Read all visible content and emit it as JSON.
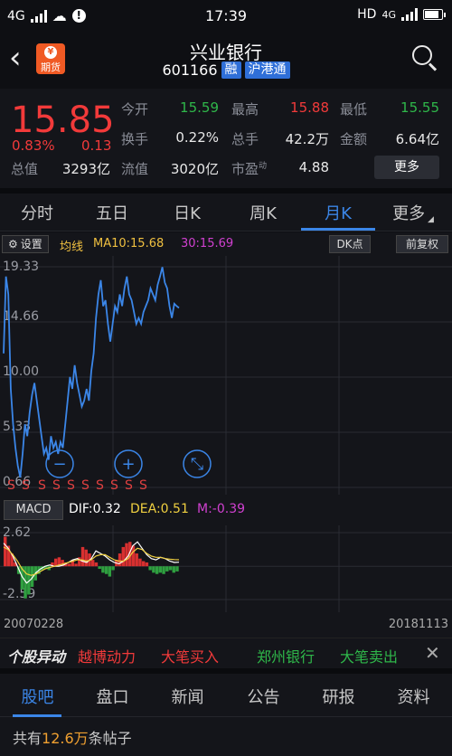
{
  "status_bar": {
    "network_left": "4G",
    "time": "17:39",
    "hd": "HD",
    "network_right": "4G"
  },
  "header": {
    "back_icon": "chevron-left-icon",
    "futures_label": "期货",
    "stock_name": "兴业银行",
    "stock_code": "601166",
    "tag_margin": "融",
    "tag_connect": "沪港通",
    "search_icon": "search-icon"
  },
  "quote": {
    "price": "15.85",
    "change_pct": "0.83%",
    "change_amt": "0.13",
    "total_value_label": "总值",
    "total_value": "3293亿",
    "rows": [
      {
        "label": "今开",
        "value": "15.59",
        "color": "green"
      },
      {
        "label": "最高",
        "value": "15.88",
        "color": "red"
      },
      {
        "label": "最低",
        "value": "15.55",
        "color": "green"
      },
      {
        "label": "换手",
        "value": "0.22%",
        "color": "white"
      },
      {
        "label": "总手",
        "value": "42.2万",
        "color": "white"
      },
      {
        "label": "金额",
        "value": "6.64亿",
        "color": "white"
      },
      {
        "label": "流值",
        "value": "3020亿",
        "color": "white"
      },
      {
        "label": "市盈",
        "superscript": "动",
        "value": "4.88",
        "color": "white"
      }
    ],
    "more_label": "更多"
  },
  "tabs": {
    "items": [
      "分时",
      "五日",
      "日K",
      "周K",
      "月K",
      "更多"
    ],
    "active_index": 4
  },
  "chart_toolbar": {
    "settings_label": "设置",
    "ma_label": "均线",
    "ma10": "MA10:15.68",
    "ma30": "30:15.69",
    "dk_label": "DK点",
    "adjust_label": "前复权",
    "colors": {
      "ma10": "#f0c040",
      "ma30": "#d040d0"
    }
  },
  "chart_data": [
    {
      "type": "line",
      "title": "",
      "y_tick_labels": [
        "19.33",
        "14.66",
        "10.00",
        "5.33",
        "0.66"
      ],
      "ylim": [
        0.66,
        19.33
      ],
      "x_range": [
        "20070228",
        "20181113"
      ],
      "series": [
        {
          "values": [
            12.0,
            18.5,
            17.0,
            9.0,
            6.0,
            4.0,
            2.5,
            1.5,
            3.5,
            6.0,
            5.0,
            7.0,
            8.5,
            9.5,
            8.0,
            6.5,
            5.0,
            3.5,
            4.0,
            3.0,
            5.0,
            4.0,
            4.5,
            3.5,
            4.5,
            4.0,
            6.0,
            8.0,
            10.0,
            9.0,
            11.0,
            9.5,
            8.5,
            7.5,
            8.0,
            9.0,
            8.0,
            10.5,
            12.0,
            15.0,
            17.0,
            18.2,
            16.0,
            16.5,
            14.5,
            13.0,
            14.5,
            16.0,
            15.5,
            17.0,
            16.0,
            17.5,
            18.5,
            17.0,
            16.5,
            15.5,
            14.5,
            15.0,
            14.5,
            15.5,
            16.0,
            16.5,
            17.5,
            17.0,
            16.5,
            17.8,
            18.5,
            19.3,
            18.0,
            17.5,
            16.0,
            15.0,
            16.2,
            16.0,
            15.85
          ]
        }
      ],
      "overlay_icons": [
        "minus-circle-icon",
        "plus-circle-icon",
        "expand-icon"
      ],
      "markers": {
        "label": "S",
        "count": 10,
        "color": "#e04040"
      },
      "line_color": "#3b86e8",
      "grid": true
    },
    {
      "type": "bar",
      "title": "",
      "y_tick_labels": [
        "2.62",
        "-2.59"
      ],
      "ylim": [
        -2.59,
        2.62
      ],
      "series": [
        {
          "name": "M",
          "values": [
            2.3,
            1.6,
            1.0,
            0.3,
            -0.6,
            -1.8,
            -2.5,
            -2.2,
            -1.6,
            -1.1,
            -0.6,
            -0.3,
            -0.2,
            -0.3,
            0.3,
            0.6,
            0.7,
            0.5,
            0.3,
            0.2,
            0.5,
            0.2,
            0.7,
            1.5,
            1.3,
            1.0,
            0.5,
            0.3,
            -0.2,
            -0.5,
            -0.6,
            -0.8,
            -0.3,
            0.5,
            1.0,
            1.5,
            1.8,
            1.9,
            1.6,
            1.0,
            0.6,
            0.4,
            0.3,
            -0.3,
            -0.5,
            -0.6,
            -0.5,
            -0.6,
            -0.4,
            -0.3,
            -0.5,
            -0.4
          ]
        },
        {
          "name": "DIF",
          "values": [
            1.8,
            1.4,
            0.8,
            0.0,
            -0.8,
            -1.3,
            -1.0,
            -0.5,
            -0.2,
            0.0,
            0.1,
            0.0,
            0.0,
            0.1,
            0.3,
            0.5,
            0.6,
            0.4,
            0.3,
            0.6,
            1.2,
            1.0,
            0.8,
            0.5,
            0.3,
            0.2,
            0.4,
            0.8,
            1.6,
            1.9,
            1.4,
            0.9,
            0.6,
            0.5,
            0.7,
            0.6,
            0.4,
            0.3,
            0.32
          ]
        },
        {
          "name": "DEA",
          "values": [
            1.5,
            1.3,
            0.9,
            0.4,
            -0.2,
            -0.6,
            -0.7,
            -0.6,
            -0.4,
            -0.2,
            -0.1,
            0.0,
            0.1,
            0.2,
            0.3,
            0.4,
            0.5,
            0.5,
            0.4,
            0.5,
            0.8,
            0.9,
            0.9,
            0.7,
            0.5,
            0.4,
            0.4,
            0.6,
            1.1,
            1.4,
            1.3,
            1.0,
            0.8,
            0.7,
            0.7,
            0.6,
            0.55,
            0.52,
            0.51
          ]
        }
      ],
      "legend": {
        "dif": "DIF:0.32",
        "dea": "DEA:0.51",
        "m": "M:-0.39"
      },
      "button_label": "MACD",
      "colors": {
        "dif": "#ffffff",
        "dea": "#f0d040",
        "m": "#d040d0",
        "up": "#d83030",
        "down": "#2fa040"
      }
    }
  ],
  "date_range": {
    "start": "20070228",
    "end": "20181113"
  },
  "news_ticker": {
    "brand": "个股异动",
    "items": [
      {
        "text": "越博动力",
        "color": "red"
      },
      {
        "text": "大笔买入",
        "color": "red"
      },
      {
        "text": "郑州银行",
        "color": "green"
      },
      {
        "text": "大笔卖出",
        "color": "green"
      }
    ],
    "close_icon": "close-icon"
  },
  "bottom_tabs": {
    "items": [
      "股吧",
      "盘口",
      "新闻",
      "公告",
      "研报",
      "资料"
    ],
    "active_index": 0
  },
  "posts": {
    "prefix": "共有",
    "count": "12.6万",
    "suffix": "条帖子"
  }
}
